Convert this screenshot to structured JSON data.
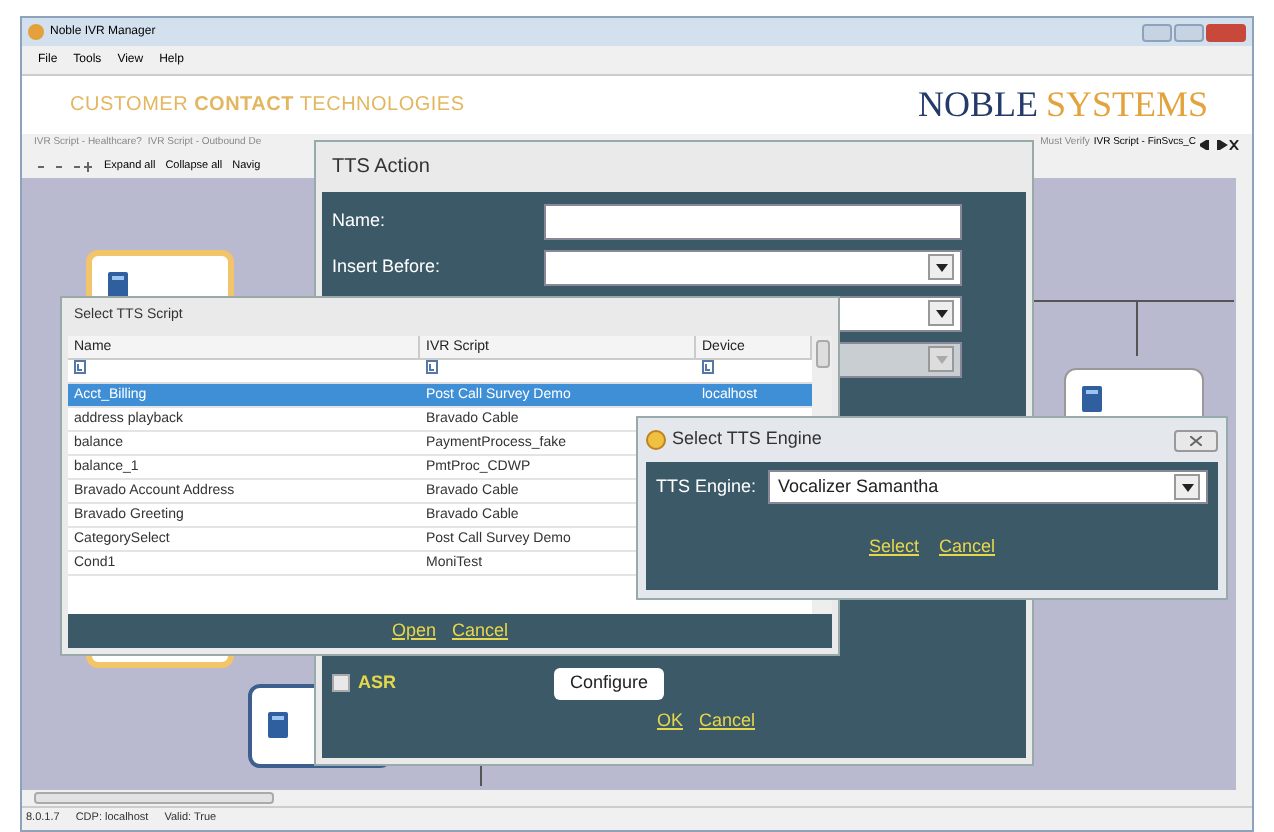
{
  "window": {
    "title": "Noble IVR Manager"
  },
  "menu": [
    "File",
    "Tools",
    "View",
    "Help"
  ],
  "banner": {
    "tagline": "CUSTOMER **CONTACT** TECHNOLOGIES",
    "logo_first": "NOBLE",
    "logo_second": "SYSTEMS"
  },
  "document_tabs": [
    {
      "label": "IVR Script - Healthcare?",
      "selected": false
    },
    {
      "label": "IVR Script - Outbound De",
      "selected": false
    },
    {
      "label": "Must Verify",
      "selected": false
    },
    {
      "label": "IVR Script - FinSvcs_C",
      "selected": true
    }
  ],
  "toolbar": [
    "Expand all",
    "Collapse all",
    "Navig"
  ],
  "tts_action": {
    "title": "TTS Action",
    "fields": [
      {
        "label": "Name:",
        "kind": "text",
        "disabled": false
      },
      {
        "label": "Insert Before:",
        "kind": "select",
        "disabled": false
      },
      {
        "kind": "select",
        "disabled": false
      },
      {
        "kind": "select",
        "disabled": true
      }
    ],
    "asr": {
      "label": "ASR",
      "checked": false
    },
    "configure": "Configure",
    "actions": [
      "OK",
      "Cancel"
    ]
  },
  "script_picker": {
    "title": "Select TTS Script",
    "columns": [
      "Name",
      "IVR Script",
      "Device"
    ],
    "rows": [
      {
        "name": "Acct_Billing",
        "ivr_script": "Post Call Survey Demo",
        "device": "localhost",
        "selected": true
      },
      {
        "name": "address playback",
        "ivr_script": "Bravado Cable",
        "selected": false
      },
      {
        "name": "balance",
        "ivr_script": "PaymentProcess_fake",
        "selected": false
      },
      {
        "name": "balance_1",
        "ivr_script": "PmtProc_CDWP",
        "selected": false
      },
      {
        "name": "Bravado Account Address",
        "ivr_script": "Bravado Cable",
        "selected": false
      },
      {
        "name": "Bravado Greeting",
        "ivr_script": "Bravado Cable",
        "selected": false
      },
      {
        "name": "CategorySelect",
        "ivr_script": "Post Call Survey Demo",
        "selected": false
      },
      {
        "name": "Cond1",
        "ivr_script": "MoniTest",
        "selected": false
      }
    ],
    "actions": [
      "Open",
      "Cancel"
    ]
  },
  "engine_picker": {
    "title": "Select TTS Engine",
    "label": "TTS Engine:",
    "value": "Vocalizer Samantha",
    "actions": [
      "Select",
      "Cancel"
    ]
  },
  "status_bar": [
    "8.0.1.7",
    "CDP: localhost",
    "Valid: True"
  ]
}
